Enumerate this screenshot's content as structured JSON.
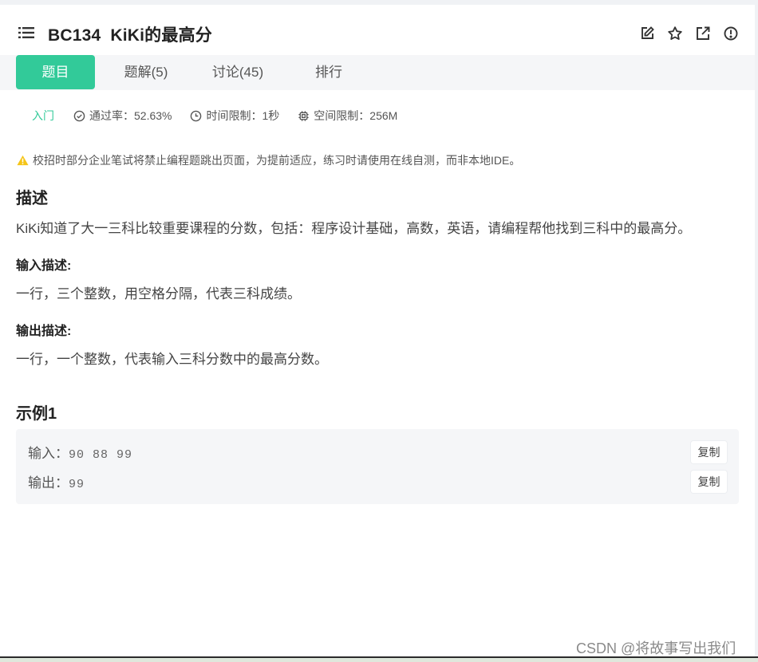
{
  "header": {
    "code": "BC134",
    "title": "KiKi的最高分"
  },
  "tabs": [
    {
      "label": "题目",
      "active": true
    },
    {
      "label": "题解(5)",
      "active": false
    },
    {
      "label": "讨论(45)",
      "active": false
    },
    {
      "label": "排行",
      "active": false
    }
  ],
  "meta": {
    "level": "入门",
    "pass_rate": "通过率：52.63%",
    "time_limit": "时间限制：1秒",
    "memory_limit": "空间限制：256M"
  },
  "notice": "校招时部分企业笔试将禁止编程题跳出页面，为提前适应，练习时请使用在线自测，而非本地IDE。",
  "description": {
    "heading": "描述",
    "text": "KiKi知道了大一三科比较重要课程的分数，包括：程序设计基础，高数，英语，请编程帮他找到三科中的最高分。"
  },
  "input_desc": {
    "heading": "输入描述:",
    "text": "一行，三个整数，用空格分隔，代表三科成绩。"
  },
  "output_desc": {
    "heading": "输出描述:",
    "text": "一行，一个整数，代表输入三科分数中的最高分数。"
  },
  "example": {
    "heading": "示例1",
    "input_label": "输入：",
    "input_value": "90 88 99",
    "output_label": "输出：",
    "output_value": "99",
    "copy_label": "复制"
  },
  "watermark": "CSDN @将故事写出我们",
  "colors": {
    "accent": "#32ca99",
    "warning": "#f5c518"
  }
}
